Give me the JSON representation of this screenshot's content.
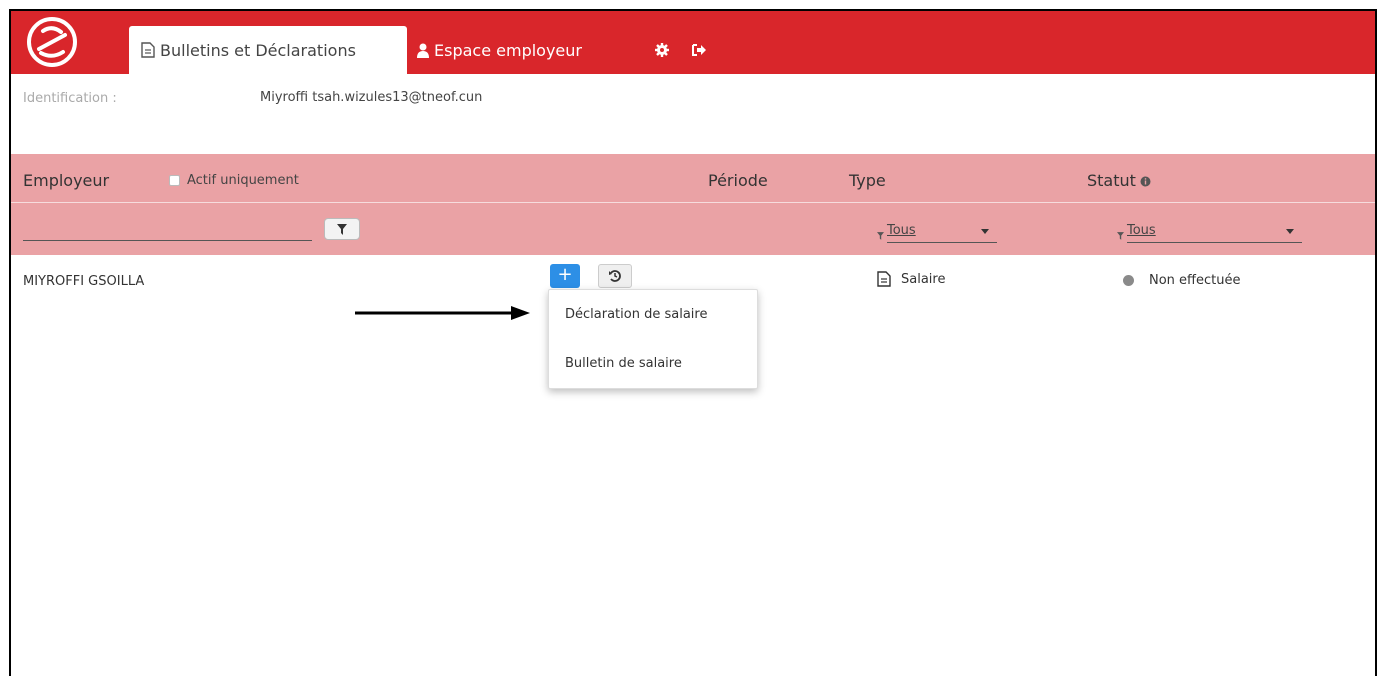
{
  "nav": {
    "tab_bulletins": "Bulletins et Déclarations",
    "tab_employer": "Espace employeur"
  },
  "identification": {
    "label": "Identification :",
    "value": "Miyroffi  tsah.wizules13@tneof.cun"
  },
  "table": {
    "headers": {
      "employeur": "Employeur",
      "actif_uniquement": "Actif uniquement",
      "periode": "Période",
      "type": "Type",
      "statut": "Statut"
    },
    "filters": {
      "type_selected": "Tous",
      "statut_selected": "Tous"
    },
    "rows": [
      {
        "employeur": "MIYROFFI GSOILLA",
        "type": "Salaire",
        "statut": "Non effectuée"
      }
    ]
  },
  "add_menu": {
    "items": [
      "Déclaration de salaire",
      "Bulletin de salaire"
    ]
  },
  "colors": {
    "topbar": "#d9262b",
    "header": "#eaa2a5",
    "add_button": "#2d8fe6"
  }
}
